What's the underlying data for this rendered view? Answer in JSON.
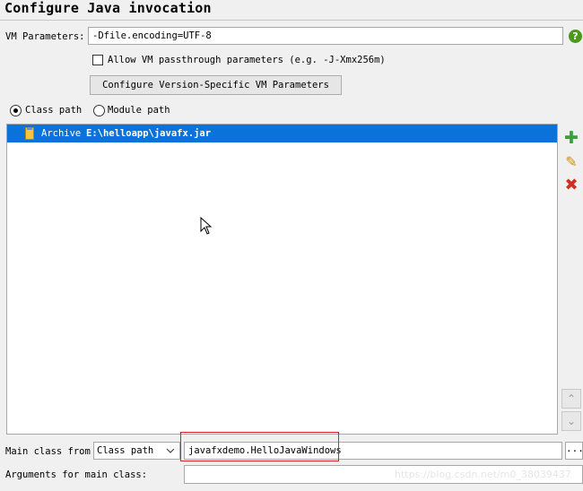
{
  "title": "Configure Java invocation",
  "vm_parameters": {
    "label": "VM Parameters:",
    "value": "-Dfile.encoding=UTF-8",
    "help_icon_text": "?"
  },
  "passthrough": {
    "label": "Allow VM passthrough parameters (e.g. -J-Xmx256m)",
    "checked": false
  },
  "configure_button_label": "Configure Version-Specific VM Parameters",
  "path_options": [
    {
      "label": "Class path",
      "selected": true
    },
    {
      "label": "Module path",
      "selected": false
    }
  ],
  "classpath_entries": [
    {
      "type": "Archive",
      "path": "E:\\helloapp\\javafx.jar",
      "selected": true
    }
  ],
  "side_buttons": {
    "add_glyph": "✚",
    "edit_glyph": "✎",
    "remove_glyph": "✖"
  },
  "scroll_buttons": {
    "up_glyph": "⌃",
    "down_glyph": "⌄"
  },
  "main_class": {
    "label": "Main class from",
    "source": "Class path",
    "value": "javafxdemo.HelloJavaWindows",
    "browse_label": "..."
  },
  "arguments": {
    "label": "Arguments for main class:",
    "value": ""
  },
  "watermark": "https://blog.csdn.net/m0_38039437",
  "colors": {
    "selection": "#0a73d9",
    "help": "#4a9a1a",
    "add": "#3aa03a",
    "remove": "#d03020",
    "highlight_border": "#e02020"
  }
}
